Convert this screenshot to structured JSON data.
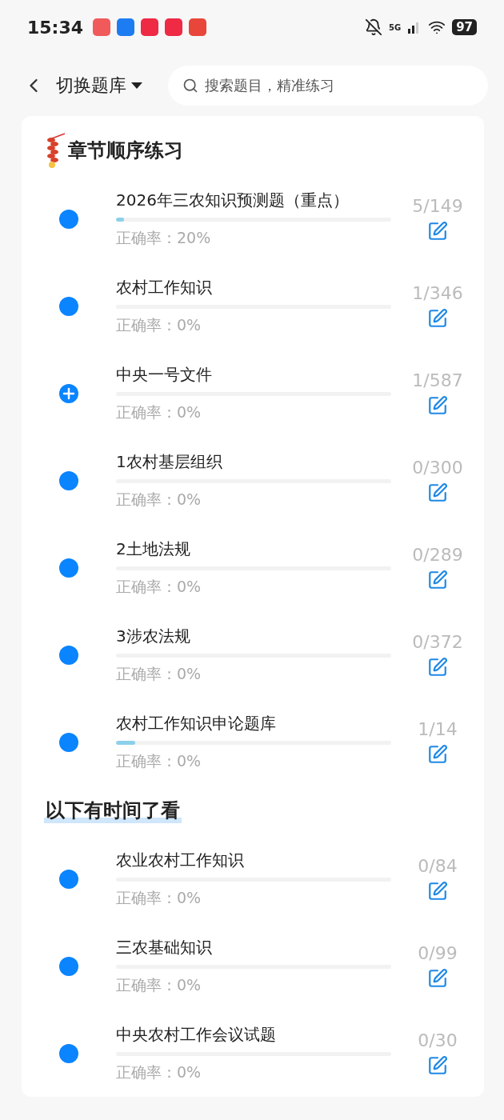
{
  "status_bar": {
    "time": "15:34",
    "battery": "97",
    "network": "5G"
  },
  "header": {
    "title": "切换题库",
    "search": {
      "placeholder": "搜索题目，精准练习"
    }
  },
  "sections": [
    {
      "title": "章节顺序练习",
      "kind": "firecracker",
      "items": [
        {
          "title": "2026年三农知识预测题（重点）",
          "kind": "dot",
          "level": 0.03,
          "accuracy": "正确率：20%",
          "count": "5/149"
        },
        {
          "title": "农村工作知识",
          "kind": "dot",
          "accuracy": "正确率：0%",
          "count": "1/346"
        },
        {
          "title": "中央一号文件",
          "kind": "plus",
          "accuracy": "正确率：0%",
          "count": "1/587"
        },
        {
          "title": "1农村基层组织",
          "kind": "dot",
          "accuracy": "正确率：0%",
          "count": "0/300"
        },
        {
          "title": "2土地法规",
          "kind": "dot",
          "accuracy": "正确率：0%",
          "count": "0/289"
        },
        {
          "title": "3涉农法规",
          "kind": "dot",
          "accuracy": "正确率：0%",
          "count": "0/372"
        },
        {
          "title": "农村工作知识申论题库",
          "kind": "dot",
          "level": 0.07,
          "accuracy": "正确率：0%",
          "count": "1/14"
        }
      ]
    },
    {
      "title": "以下有时间了看",
      "kind": "underline",
      "items": [
        {
          "title": "农业农村工作知识",
          "kind": "dot",
          "accuracy": "正确率：0%",
          "count": "0/84"
        },
        {
          "title": "三农基础知识",
          "kind": "dot",
          "accuracy": "正确率：0%",
          "count": "0/99"
        },
        {
          "title": "中央农村工作会议试题",
          "kind": "dot",
          "accuracy": "正确率：0%",
          "count": "0/30"
        }
      ]
    }
  ]
}
